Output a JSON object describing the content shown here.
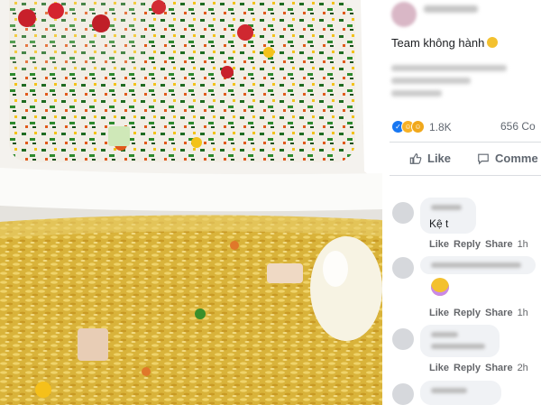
{
  "post": {
    "caption": "Team không hành",
    "reaction_count": "1.8K",
    "comment_count": "656 Co"
  },
  "actions": {
    "like_label": "Like",
    "comment_label": "Comme"
  },
  "comments": [
    {
      "text": "Kệ t",
      "like": "Like",
      "reply": "Reply",
      "share": "Share",
      "time": "1h"
    },
    {
      "text": "",
      "like": "Like",
      "reply": "Reply",
      "share": "Share",
      "time": "1h"
    },
    {
      "text": "",
      "like": "Like",
      "reply": "Reply",
      "share": "Share",
      "time": "2h"
    }
  ],
  "colors": {
    "accent": "#1877f2",
    "bubble": "#f0f2f5",
    "muted_text": "#65676b"
  }
}
